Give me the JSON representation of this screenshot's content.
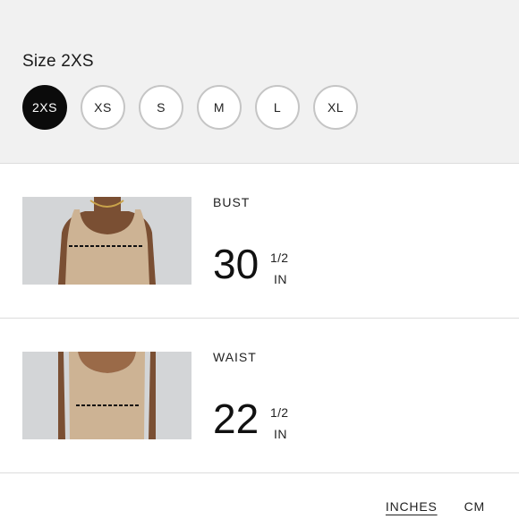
{
  "size_selector": {
    "title": "Size 2XS",
    "options": [
      {
        "label": "2XS",
        "selected": true
      },
      {
        "label": "XS",
        "selected": false
      },
      {
        "label": "S",
        "selected": false
      },
      {
        "label": "M",
        "selected": false
      },
      {
        "label": "L",
        "selected": false
      },
      {
        "label": "XL",
        "selected": false
      }
    ]
  },
  "measurements": [
    {
      "label": "BUST",
      "whole": "30",
      "fraction": "1/2",
      "unit": "IN"
    },
    {
      "label": "WAIST",
      "whole": "22",
      "fraction": "1/2",
      "unit": "IN"
    }
  ],
  "unit_toggle": {
    "options": [
      {
        "label": "INCHES",
        "active": true
      },
      {
        "label": "CM",
        "active": false
      }
    ]
  },
  "colors": {
    "selected_bg": "#0b0b0b",
    "panel_bg": "#f1f1f1",
    "garment": "#cfb698",
    "skin": "#7a4f33"
  }
}
